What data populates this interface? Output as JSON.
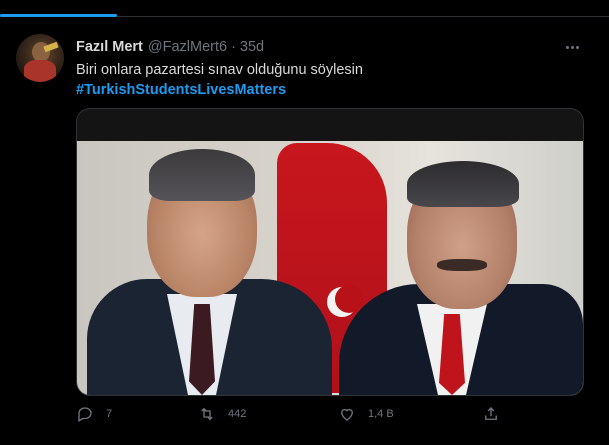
{
  "tweet": {
    "author_name": "Fazıl Mert",
    "handle": "@FazlMert6",
    "separator": "·",
    "time": "35d",
    "text": "Biri onlara pazartesi sınav olduğunu söylesin",
    "hashtag": "#TurkishStudentsLivesMatters"
  },
  "actions": {
    "reply_count": "7",
    "retweet_count": "442",
    "like_count": "1,4 B"
  },
  "colors": {
    "background": "#000000",
    "accent": "#1d9bf0",
    "muted_text": "#6e767d",
    "primary_text": "#d9d9d9"
  },
  "icons": [
    "more-icon",
    "reply-icon",
    "retweet-icon",
    "like-icon",
    "share-icon"
  ]
}
